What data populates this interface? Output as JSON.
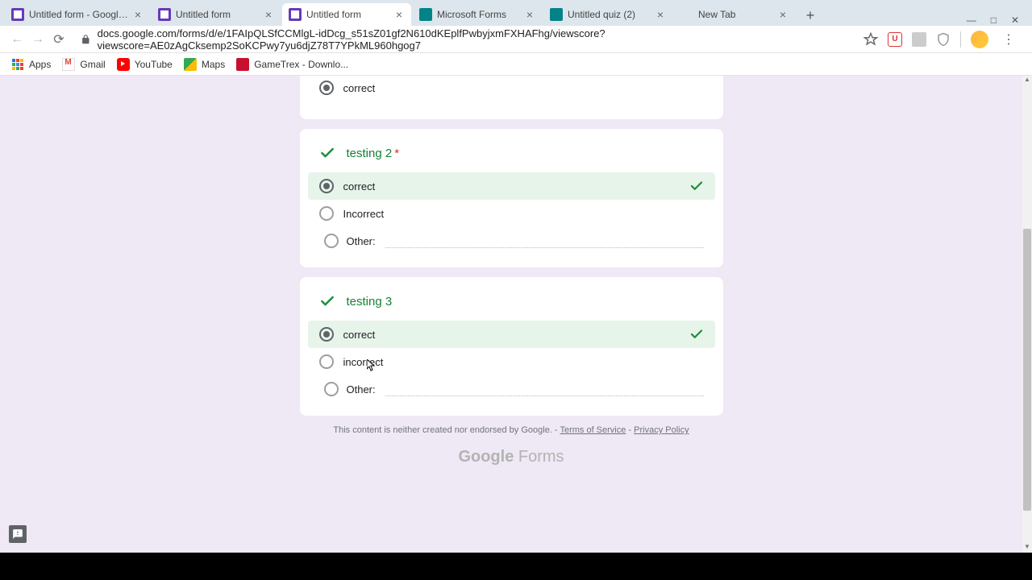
{
  "browser": {
    "tabs": [
      {
        "title": "Untitled form - Google Form",
        "favicon": "purple",
        "active": false
      },
      {
        "title": "Untitled form",
        "favicon": "purple",
        "active": false
      },
      {
        "title": "Untitled form",
        "favicon": "purple",
        "active": true
      },
      {
        "title": "Microsoft Forms",
        "favicon": "teal",
        "active": false
      },
      {
        "title": "Untitled quiz (2)",
        "favicon": "teal",
        "active": false
      },
      {
        "title": "New Tab",
        "favicon": "none",
        "active": false
      }
    ],
    "url": "docs.google.com/forms/d/e/1FAIpQLSfCCMlgL-idDcg_s51sZ01gf2N610dKEplfPwbyjxmFXHAFhg/viewscore?viewscore=AE0zAgCksemp2SoKCPwy7yu6djZ78T7YPkML960hgog7"
  },
  "bookmarks": [
    {
      "label": "Apps",
      "icon": "apps"
    },
    {
      "label": "Gmail",
      "icon": "gmail"
    },
    {
      "label": "YouTube",
      "icon": "youtube"
    },
    {
      "label": "Maps",
      "icon": "maps"
    },
    {
      "label": "GameTrex - Downlo...",
      "icon": "gametrex"
    }
  ],
  "q1": {
    "selected_label": "correct"
  },
  "q2": {
    "title": "testing 2",
    "required": true,
    "options": {
      "a": "correct",
      "b": "Incorrect",
      "other": "Other:"
    }
  },
  "q3": {
    "title": "testing 3",
    "required": false,
    "options": {
      "a": "correct",
      "b": "incorrect",
      "other": "Other:"
    }
  },
  "footer": {
    "disclaimer": "This content is neither created nor endorsed by Google. - ",
    "tos": "Terms of Service",
    "sep": " - ",
    "privacy": "Privacy Policy",
    "logo_a": "Google",
    "logo_b": " Forms"
  }
}
